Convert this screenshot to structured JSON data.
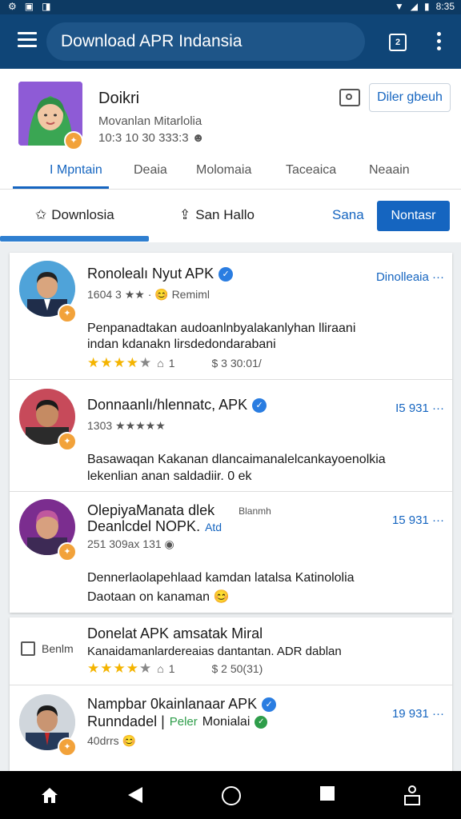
{
  "status_bar": {
    "time": "8:35"
  },
  "app_bar": {
    "title": "Download APR Indansia"
  },
  "profile": {
    "name": "Doikri",
    "subtitle": "Movanlan Mitarlolia",
    "stats": "10:3 10 30 333:3",
    "follow_label": "Diler gbeuh",
    "tabs": [
      "I Mpntain",
      "Deaia",
      "Molomaia",
      "Taceaica",
      "Neaain"
    ]
  },
  "actions": {
    "download_label": "Downlosia",
    "share_label": "San Hallo",
    "sana_label": "Sana",
    "primary_label": "Nontasr"
  },
  "list1": [
    {
      "title": "Ronolealı Nyut APK",
      "meta": "1604 3 ★★ · 😊 Remiml",
      "right": "Dinolleaia ···",
      "desc1": "Penpanadtakan audoanlnbyalakanlyhan lliraani",
      "desc2": "indan kdanakn lirsdedondarabani",
      "rating_count": "1",
      "price": "$ 3 30:01/"
    },
    {
      "title": "Donnaanlı/hlennatc, APK",
      "meta": "1303 ★★★★★",
      "right": "I5 931 ···",
      "desc1": "Basawaqan Kakanan dlancaimanalelcankayoenolkia",
      "desc2": "lekenlian anan saldadiir. 0 ek"
    },
    {
      "title": "OlepiyaManata dlek",
      "title_extra": "Blanmh",
      "title2": "Deanlcdel  NOPK.",
      "title2_extra": "Atd",
      "meta": "251 309ax 131",
      "right": "15 931 ···",
      "desc1": "Dennerlaolapehlaad kamdan latalsa Katinololia",
      "desc2": "Daotaan on kanaman"
    }
  ],
  "list2": [
    {
      "icon_label": "Benlm",
      "title": "Donelat APK amsatak Miral",
      "desc": "Kanaidamanlardereaias dantantan. ADR dablan",
      "rating_count": "1",
      "price": "$ 2 50(31)"
    },
    {
      "title": "Nampbar 0kainlanaar APK",
      "title2": "Runndadel |",
      "tag": "Peler",
      "title2_rest": "Monialai",
      "meta": "40drrs",
      "right": "19 931 ···"
    }
  ]
}
